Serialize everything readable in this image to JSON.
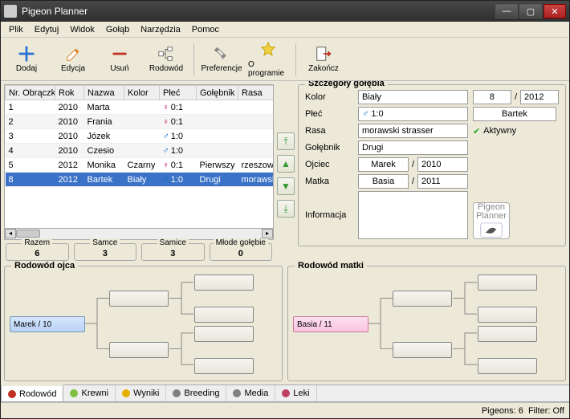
{
  "window": {
    "title": "Pigeon Planner"
  },
  "menu": [
    "Plik",
    "Edytuj",
    "Widok",
    "Gołąb",
    "Narzędzia",
    "Pomoc"
  ],
  "toolbar": [
    {
      "label": "Dodaj",
      "icon": "plus",
      "color": "#2a6fd6"
    },
    {
      "label": "Edycja",
      "icon": "pencil",
      "color": "#e08020"
    },
    {
      "label": "Usuń",
      "icon": "minus",
      "color": "#c03020"
    },
    {
      "label": "Rodowód",
      "icon": "tree",
      "color": "#666"
    },
    {
      "label": "Preferencje",
      "icon": "tools",
      "color": "#777"
    },
    {
      "label": "O programie",
      "icon": "star",
      "color": "#e6c020"
    },
    {
      "label": "Zakończ",
      "icon": "exit",
      "color": "#c03020"
    }
  ],
  "columns": [
    "Nr. Obrączki",
    "Rok",
    "Nazwa",
    "Kolor",
    "Płeć",
    "Gołębnik",
    "Rasa"
  ],
  "rows": [
    {
      "nr": "1",
      "rok": "2010",
      "nazwa": "Marta",
      "kolor": "",
      "sex": "f",
      "ratio": "0:1",
      "gol": "",
      "rasa": ""
    },
    {
      "nr": "2",
      "rok": "2010",
      "nazwa": "Frania",
      "kolor": "",
      "sex": "f",
      "ratio": "0:1",
      "gol": "",
      "rasa": ""
    },
    {
      "nr": "3",
      "rok": "2010",
      "nazwa": "Józek",
      "kolor": "",
      "sex": "m",
      "ratio": "1:0",
      "gol": "",
      "rasa": ""
    },
    {
      "nr": "4",
      "rok": "2010",
      "nazwa": "Czesio",
      "kolor": "",
      "sex": "m",
      "ratio": "1:0",
      "gol": "",
      "rasa": ""
    },
    {
      "nr": "5",
      "rok": "2012",
      "nazwa": "Monika",
      "kolor": "Czarny",
      "sex": "f",
      "ratio": "0:1",
      "gol": "Pierwszy",
      "rasa": "rzeszowsk"
    },
    {
      "nr": "8",
      "rok": "2012",
      "nazwa": "Bartek",
      "kolor": "Biały",
      "sex": "m",
      "ratio": "1:0",
      "gol": "Drugi",
      "rasa": "morawski"
    }
  ],
  "selected_row": 5,
  "summary": {
    "razem_l": "Razem",
    "razem_v": "6",
    "samce_l": "Samce",
    "samce_v": "3",
    "samice_l": "Samice",
    "samice_v": "3",
    "mlode_l": "Młode gołębie",
    "mlode_v": "0"
  },
  "details": {
    "title": "Szczegóły gołębia",
    "kolor_l": "Kolor",
    "kolor": "Biały",
    "ring": "8",
    "year": "2012",
    "plec_l": "Płeć",
    "sex_icon": "m",
    "plec": "1:0",
    "nazwa": "Bartek",
    "rasa_l": "Rasa",
    "rasa": "morawski strasser",
    "status_icon": "ok",
    "status": "Aktywny",
    "golebnik_l": "Gołębnik",
    "golebnik": "Drugi",
    "ojciec_l": "Ojciec",
    "ojciec": "Marek",
    "ojciec_y": "2010",
    "matka_l": "Matka",
    "matka": "Basia",
    "matka_y": "2011",
    "informacja_l": "Informacja",
    "informacja": "",
    "logo_t1": "Pigeon",
    "logo_t2": "Planner"
  },
  "ped_father": {
    "title": "Rodowód ojca",
    "root": "Marek / 10"
  },
  "ped_mother": {
    "title": "Rodowód matki",
    "root": "Basia / 11"
  },
  "tabs": [
    {
      "label": "Rodowód",
      "color": "#c03020"
    },
    {
      "label": "Krewni",
      "color": "#80c040"
    },
    {
      "label": "Wyniki",
      "color": "#e6b000"
    },
    {
      "label": "Breeding",
      "color": "#808080"
    },
    {
      "label": "Media",
      "color": "#808080"
    },
    {
      "label": "Leki",
      "color": "#c04060"
    }
  ],
  "status": {
    "pigeons_l": "Pigeons:",
    "pigeons_v": "6",
    "filter_l": "Filter:",
    "filter_v": "Off"
  }
}
